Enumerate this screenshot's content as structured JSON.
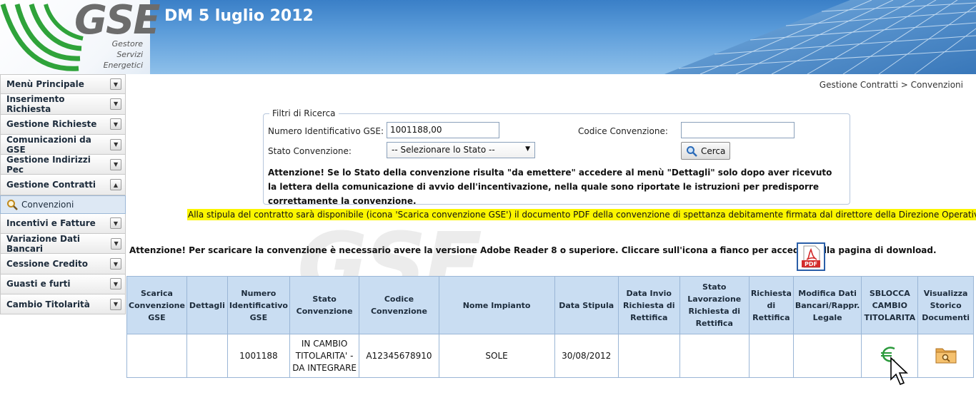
{
  "header": {
    "logo_main": "GSE",
    "logo_sub_lines": [
      "Gestore",
      "Servizi",
      "Energetici"
    ],
    "title": "DM 5 luglio 2012"
  },
  "sidebar": {
    "items": [
      {
        "label": "Menù Principale",
        "icon": "chevron-down-icon"
      },
      {
        "label": "Inserimento Richiesta",
        "icon": "chevron-down-icon"
      },
      {
        "label": "Gestione Richieste",
        "icon": "chevron-down-icon"
      },
      {
        "label": "Comunicazioni da GSE",
        "icon": "chevron-down-icon"
      },
      {
        "label": "Gestione Indirizzi Pec",
        "icon": "chevron-down-icon"
      },
      {
        "label": "Gestione Contratti",
        "icon": "chevron-up-icon"
      },
      {
        "label": "Incentivi e Fatture",
        "icon": "chevron-down-icon"
      },
      {
        "label": "Variazione Dati Bancari",
        "icon": "chevron-down-icon"
      },
      {
        "label": "Cessione Credito",
        "icon": "chevron-down-icon"
      },
      {
        "label": "Guasti e furti",
        "icon": "chevron-down-icon"
      },
      {
        "label": "Cambio Titolarità",
        "icon": "chevron-down-icon"
      }
    ],
    "sub_item": {
      "label": "Convenzioni",
      "icon": "search-icon"
    }
  },
  "breadcrumb": {
    "text": "Gestione Contratti > Convenzioni"
  },
  "filters": {
    "legend": "Filtri di Ricerca",
    "numero_label": "Numero Identificativo GSE:",
    "numero_value": "1001188,00",
    "codice_label": "Codice Convenzione:",
    "codice_value": "",
    "stato_label": "Stato Convenzione:",
    "stato_selected": "-- Selezionare lo Stato --",
    "search_button": "Cerca",
    "note": "Attenzione! Se lo Stato della convenzione risulta \"da emettere\" accedere al menù \"Dettagli\" solo dopo aver ricevuto la lettera della comunicazione di avvio dell'incentivazione, nella quale sono riportate le istruzioni per predisporre correttamente la convenzione."
  },
  "yellow_notice": "Alla stipula del contratto sarà disponibile (icona 'Scarica convenzione GSE') il documento PDF della convenzione di spettanza debitamente firmata dal direttore della Direzione Operativa",
  "watermark": "GSE",
  "attention": "Attenzione! Per scaricare la convenzione è necessario avere la versione Adobe Reader 8 o superiore. Cliccare sull'icona a fianco per accedere alla pagina di download.",
  "pdf_label": "PDF",
  "table": {
    "headers": [
      "Scarica Convenzione GSE",
      "Dettagli",
      "Numero Identificativo GSE",
      "Stato Convenzione",
      "Codice Convenzione",
      "Nome Impianto",
      "Data Stipula",
      "Data Invio Richiesta di Rettifica",
      "Stato Lavorazione Richiesta di Rettifica",
      "Richiesta di Rettifica",
      "Modifica Dati Bancari/Rappr. Legale",
      "SBLOCCA CAMBIO TITOLARITA",
      "Visualizza Storico Documenti"
    ],
    "rows": [
      {
        "scarica": "",
        "dettagli": "",
        "numero": "1001188",
        "stato": "IN CAMBIO TITOLARITA' - DA INTEGRARE",
        "codice": "A12345678910",
        "nome": "SOLE",
        "data_stipula": "30/08/2012",
        "data_invio": "",
        "stato_lavorazione": "",
        "richiesta": "",
        "modifica": "",
        "sblocca_icon": "euro-icon",
        "storico_icon": "folder-search-icon"
      }
    ]
  }
}
